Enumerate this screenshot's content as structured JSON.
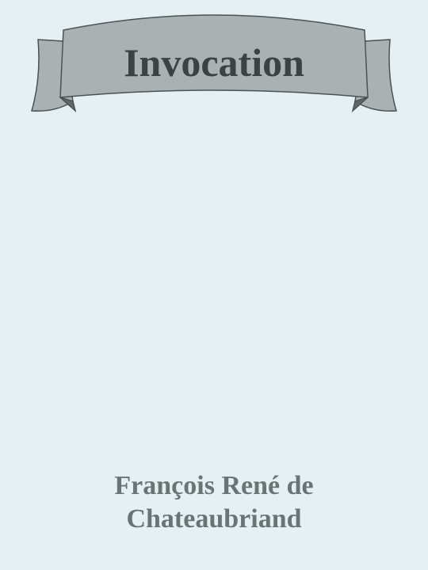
{
  "cover": {
    "title": "Invocation",
    "author_line1": "François René de",
    "author_line2": "Chateaubriand"
  },
  "colors": {
    "background": "#e4f0f4",
    "banner_fill": "#a9b1b3",
    "banner_fold": "#5e6769",
    "banner_stroke": "#4a5254",
    "title_text": "#3a4244",
    "author_text": "#6a7475"
  }
}
